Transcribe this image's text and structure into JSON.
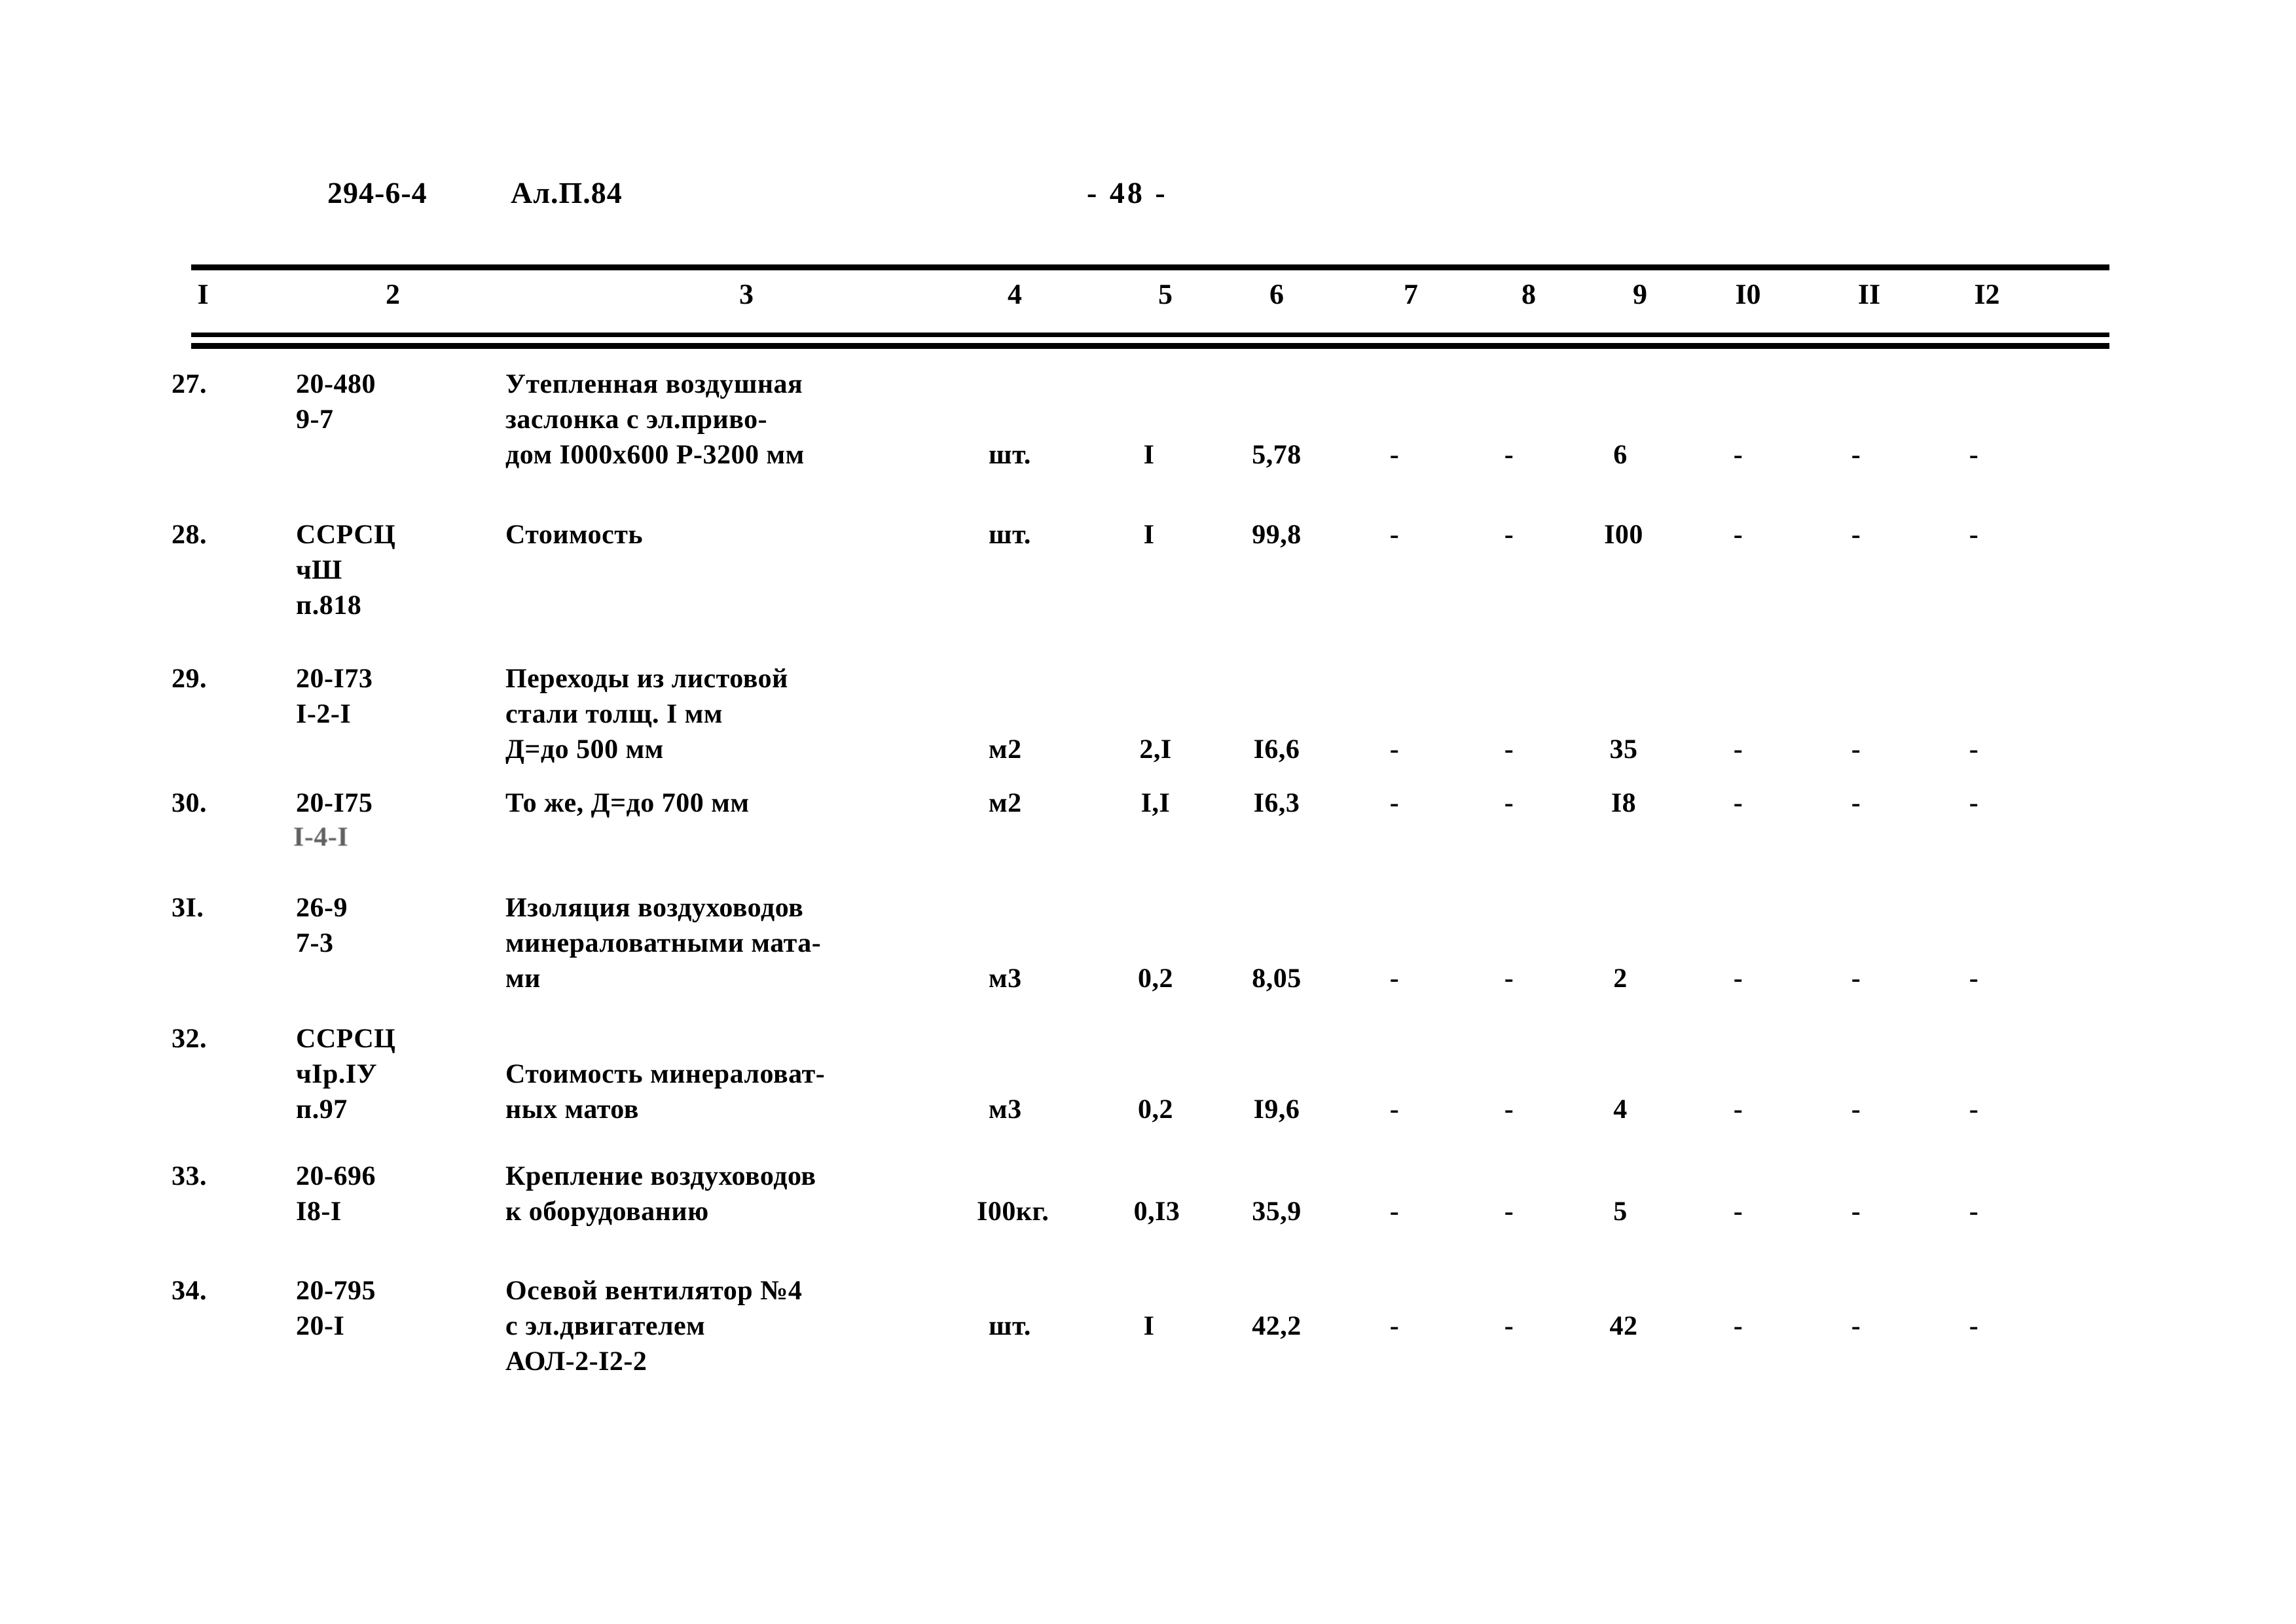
{
  "header": {
    "doc_code": "294-6-4",
    "album": "Ал.П.84",
    "page_number": "- 48 -"
  },
  "table": {
    "column_headers": [
      "I",
      "2",
      "3",
      "4",
      "5",
      "6",
      "7",
      "8",
      "9",
      "I0",
      "II",
      "I2"
    ],
    "rows": [
      {
        "num": "27.",
        "code": "20-480\n9-7",
        "name": "Утепленная воздушная\nзаслонка с эл.приво-\nдом I000х600 Р-3200 мм",
        "unit": "шт.",
        "c5": "I",
        "c6": "5,78",
        "c7": "-",
        "c8": "-",
        "c9": "6",
        "c10": "-",
        "c11": "-",
        "c12": "-"
      },
      {
        "num": "28.",
        "code": "ССРСЦ\nчШ\nп.818",
        "name": "Стоимость",
        "unit": "шт.",
        "c5": "I",
        "c6": "99,8",
        "c7": "-",
        "c8": "-",
        "c9": "I00",
        "c10": "-",
        "c11": "-",
        "c12": "-"
      },
      {
        "num": "29.",
        "code": "20-I73\nI-2-I",
        "name": "Переходы из листовой\nстали толщ. I мм\nД=до 500 мм",
        "unit": "м2",
        "c5": "2,I",
        "c6": "I6,6",
        "c7": "-",
        "c8": "-",
        "c9": "35",
        "c10": "-",
        "c11": "-",
        "c12": "-"
      },
      {
        "num": "30.",
        "code": "20-I75",
        "code_faint": "I-4-I",
        "name": "То же, Д=до 700 мм",
        "unit": "м2",
        "c5": "I,I",
        "c6": "I6,3",
        "c7": "-",
        "c8": "-",
        "c9": "I8",
        "c10": "-",
        "c11": "-",
        "c12": "-"
      },
      {
        "num": "3I.",
        "code": "26-9\n7-3",
        "name": "Изоляция воздуховодов\nминераловатными мата-\nми",
        "unit": "м3",
        "c5": "0,2",
        "c6": "8,05",
        "c7": "-",
        "c8": "-",
        "c9": "2",
        "c10": "-",
        "c11": "-",
        "c12": "-"
      },
      {
        "num": "32.",
        "code": "ССРСЦ\nчIр.IУ\nп.97",
        "name": "Стоимость минераловат-\nных матов",
        "unit": "м3",
        "c5": "0,2",
        "c6": "I9,6",
        "c7": "-",
        "c8": "-",
        "c9": "4",
        "c10": "-",
        "c11": "-",
        "c12": "-"
      },
      {
        "num": "33.",
        "code": "20-696\nI8-I",
        "name": "Крепление воздуховодов\nк оборудованию",
        "unit": "I00кг.",
        "c5": "0,I3",
        "c6": "35,9",
        "c7": "-",
        "c8": "-",
        "c9": "5",
        "c10": "-",
        "c11": "-",
        "c12": "-"
      },
      {
        "num": "34.",
        "code": "20-795\n20-I",
        "name": "Осевой вентилятор №4\nс эл.двигателем\nАОЛ-2-I2-2",
        "unit": "шт.",
        "c5": "I",
        "c6": "42,2",
        "c7": "-",
        "c8": "-",
        "c9": "42",
        "c10": "-",
        "c11": "-",
        "c12": "-"
      }
    ]
  }
}
